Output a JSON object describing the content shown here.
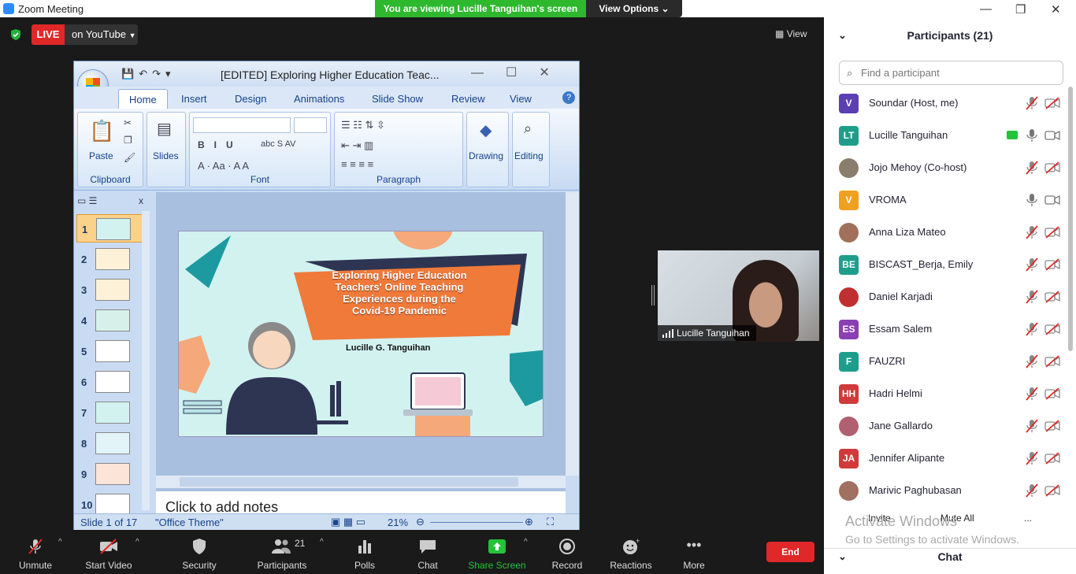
{
  "window": {
    "title": "Zoom Meeting"
  },
  "banner": {
    "viewing": "You are viewing Lucille Tanguihan's screen",
    "view_options": "View Options"
  },
  "stream": {
    "live": "LIVE",
    "platform": "on YouTube"
  },
  "view_label": "View",
  "powerpoint": {
    "title": "[EDITED] Exploring Higher Education Teac...",
    "tabs": [
      "Home",
      "Insert",
      "Design",
      "Animations",
      "Slide Show",
      "Review",
      "View"
    ],
    "groups": {
      "clipboard": "Clipboard",
      "paste": "Paste",
      "slides": "Slides",
      "font": "Font",
      "paragraph": "Paragraph",
      "drawing": "Drawing",
      "editing": "Editing"
    },
    "thumbnails": [
      "1",
      "2",
      "3",
      "4",
      "5",
      "6",
      "7",
      "8",
      "9",
      "10"
    ],
    "slide": {
      "title": "Exploring Higher Education Teachers' Online Teaching Experiences during the Covid-19 Pandemic",
      "author": "Lucille G. Tanguihan"
    },
    "notes_placeholder": "Click to add notes",
    "status": {
      "slide": "Slide 1 of 17",
      "theme": "\"Office Theme\"",
      "zoom": "21%"
    }
  },
  "video_tile": {
    "name": "Lucille Tanguihan"
  },
  "toolbar": {
    "unmute": "Unmute",
    "start_video": "Start Video",
    "security": "Security",
    "participants": "Participants",
    "participants_count": "21",
    "polls": "Polls",
    "chat": "Chat",
    "share_screen": "Share Screen",
    "record": "Record",
    "reactions": "Reactions",
    "more": "More",
    "end": "End"
  },
  "panel": {
    "title": "Participants (21)",
    "search_placeholder": "Find a participant",
    "participants": [
      {
        "name": "Soundar (Host, me)",
        "initials": "V",
        "color": "#5b3fb3",
        "muted": true
      },
      {
        "name": "Lucille Tanguihan",
        "initials": "LT",
        "color": "#1e9e8a",
        "muted": false,
        "sharing": true
      },
      {
        "name": "Jojo Mehoy (Co-host)",
        "initials": "",
        "color": "#8a7d6b",
        "muted": true
      },
      {
        "name": "VROMA",
        "initials": "V",
        "color": "#f0a020",
        "muted": false
      },
      {
        "name": "Anna Liza Mateo",
        "initials": "",
        "color": "#a0705a",
        "muted": true
      },
      {
        "name": "BISCAST_Berja, Emily",
        "initials": "BE",
        "color": "#1e9e8a",
        "muted": true
      },
      {
        "name": "Daniel Karjadi",
        "initials": "",
        "color": "#c03030",
        "muted": true
      },
      {
        "name": "Essam Salem",
        "initials": "ES",
        "color": "#8a3fb3",
        "muted": true
      },
      {
        "name": "FAUZRI",
        "initials": "F",
        "color": "#1e9e8a",
        "muted": true
      },
      {
        "name": "Hadri Helmi",
        "initials": "HH",
        "color": "#d03a3a",
        "muted": true
      },
      {
        "name": "Jane Gallardo",
        "initials": "",
        "color": "#b06070",
        "muted": true
      },
      {
        "name": "Jennifer Alipante",
        "initials": "JA",
        "color": "#d03a3a",
        "muted": true
      },
      {
        "name": "Marivic Paghubasan",
        "initials": "",
        "color": "#a07060",
        "muted": true
      }
    ],
    "invite": "Invite",
    "mute_all": "Mute All",
    "more": "...",
    "chat": "Chat"
  },
  "watermark": {
    "title": "Activate Windows",
    "subtitle": "Go to Settings to activate Windows."
  }
}
